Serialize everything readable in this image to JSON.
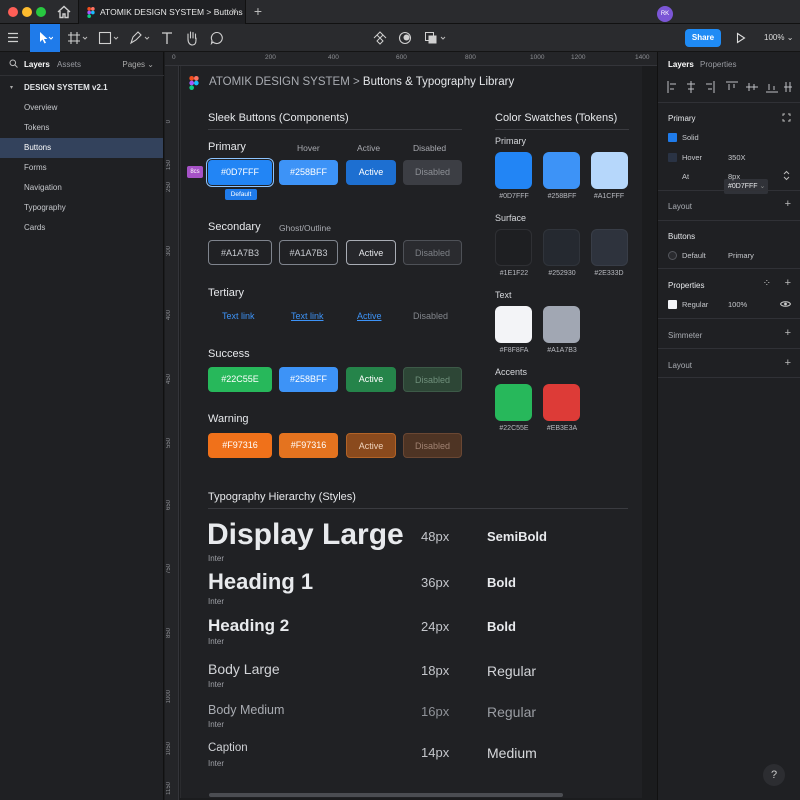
{
  "window": {
    "tab_title": "ATOMIK DESIGN SYSTEM > Buttons",
    "close_glyph": "×",
    "new_tab_glyph": "+"
  },
  "toolbar": {
    "avatar_initials": "RK",
    "share_label": "Share",
    "zoom_level": "100%"
  },
  "left_panel": {
    "tabs": [
      "Layers",
      "Assets"
    ],
    "pages_label": "Pages",
    "root": "DESIGN SYSTEM v2.1",
    "items": [
      "Overview",
      "Tokens",
      "Buttons",
      "Forms",
      "Navigation",
      "Typography",
      "Cards"
    ],
    "selected_index": 2
  },
  "rulers": {
    "top": [
      "0",
      "200",
      "400",
      "600",
      "800",
      "1000",
      "1200",
      "1400"
    ],
    "left": [
      "0",
      "150",
      "250",
      "300",
      "400",
      "450",
      "550",
      "650",
      "750",
      "850",
      "1000",
      "1050",
      "1150"
    ]
  },
  "canvas": {
    "frame_title_prefix": "ATOMIK DESIGN SYSTEM > ",
    "frame_title_main": "Buttons & Typography Library",
    "buttons_section": {
      "title": "Sleek Buttons (Components)",
      "columns": [
        "Hover",
        "Active",
        "Disabled"
      ],
      "rows": [
        {
          "label": "Primary",
          "buttons": [
            "#0D7FFF",
            "#258BFF",
            "Active",
            "Disabled"
          ]
        },
        {
          "label": "Secondary",
          "sub_label": "Ghost/Outline",
          "buttons": [
            "#A1A7B3",
            "#A1A7B3",
            "Active",
            "Disabled"
          ]
        },
        {
          "label": "Tertiary",
          "buttons": [
            "Text link",
            "Text link",
            "Active",
            "Disabled"
          ]
        },
        {
          "label": "Success",
          "buttons": [
            "#22C55E",
            "#258BFF",
            "Active",
            "Disabled"
          ]
        },
        {
          "label": "Warning",
          "buttons": [
            "#F97316",
            "#F97316",
            "Active",
            "Disabled"
          ]
        }
      ],
      "selection_badge": "Default",
      "measure_badge": "8cs"
    },
    "swatches_section": {
      "title": "Color Swatches (Tokens)",
      "groups": [
        {
          "name": "Primary",
          "items": [
            {
              "hex": "#0D7FFF",
              "color": "#2285f5"
            },
            {
              "hex": "#258BFF",
              "color": "#3d93f7"
            },
            {
              "hex": "#A1CFFF",
              "color": "#b6d7fb"
            }
          ]
        },
        {
          "name": "Surface",
          "items": [
            {
              "hex": "#1E1F22",
              "color": "#1e1f22"
            },
            {
              "hex": "#252930",
              "color": "#252930"
            },
            {
              "hex": "#2E333D",
              "color": "#2e333d"
            }
          ]
        },
        {
          "name": "Text",
          "items": [
            {
              "hex": "#F8F8FA",
              "color": "#f3f4f7"
            },
            {
              "hex": "#A1A7B3",
              "color": "#a1a7b3"
            }
          ]
        },
        {
          "name": "Accents",
          "items": [
            {
              "hex": "#22C55E",
              "color": "#27b85b"
            },
            {
              "hex": "#EB3E3A",
              "color": "#dd3b37"
            }
          ]
        }
      ]
    },
    "typography_section": {
      "title": "Typography Hierarchy (Styles)",
      "rows": [
        {
          "name": "Display Large",
          "font": "Inter",
          "size": "48px",
          "weight": "SemiBold"
        },
        {
          "name": "Heading 1",
          "font": "Inter",
          "size": "36px",
          "weight": "Bold"
        },
        {
          "name": "Heading 2",
          "font": "Inter",
          "size": "24px",
          "weight": "Bold"
        },
        {
          "name": "Body Large",
          "font": "Inter",
          "size": "18px",
          "weight": "Regular"
        },
        {
          "name": "Body Medium",
          "font": "Inter",
          "size": "16px",
          "weight": "Regular"
        },
        {
          "name": "Caption",
          "font": "Inter",
          "size": "14px",
          "weight": "Medium"
        }
      ]
    }
  },
  "right_panel": {
    "tabs": [
      "Layers",
      "Properties"
    ],
    "primary_section": {
      "title": "Primary",
      "solid_label": "Solid",
      "solid_value": "#0D7FFF",
      "hover_label": "Hover",
      "hover_value": "350X",
      "at_label": "At",
      "at_value": "8px"
    },
    "layout_label": "Layout",
    "buttons_section": {
      "title": "Buttons",
      "default_label": "Default",
      "variant": "Primary"
    },
    "properties_section": {
      "title": "Properties",
      "fill_label": "Regular",
      "opacity": "100%"
    },
    "shimmer_label": "Simmeter",
    "layout2_label": "Layout",
    "help_glyph": "?"
  },
  "colors": {
    "accent": "#1f8bf5",
    "primary": "#2285f5",
    "success": "#27b85b",
    "warning": "#f0711a"
  }
}
